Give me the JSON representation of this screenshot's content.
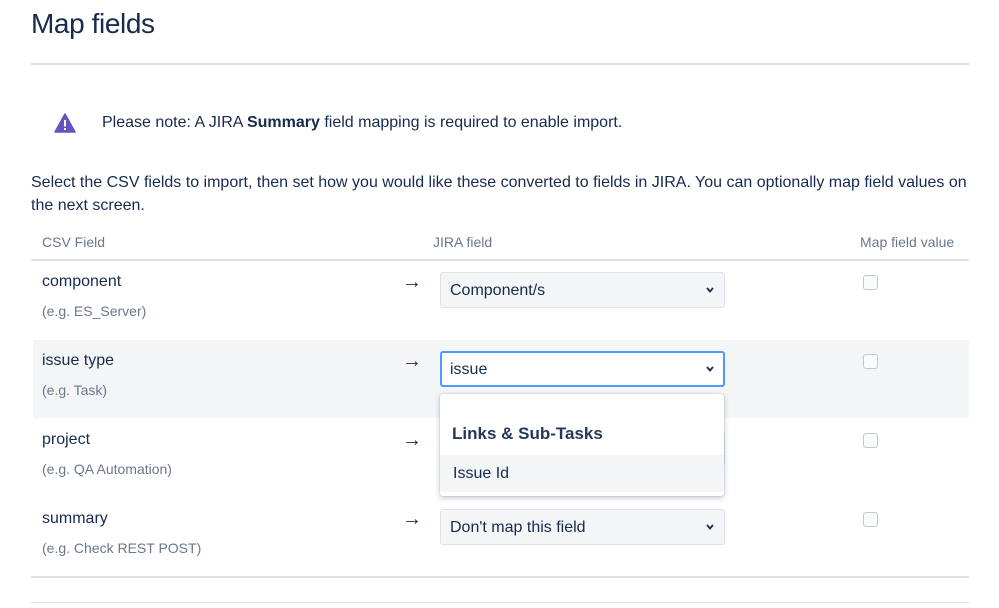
{
  "page": {
    "title": "Map fields"
  },
  "note": {
    "prefix": "Please note: A JIRA ",
    "bold": "Summary",
    "suffix": " field mapping is required to enable import."
  },
  "intro": "Select the CSV fields to import, then set how you would like these converted to fields in JIRA. You can optionally map field values on the next screen.",
  "table": {
    "headers": {
      "csv": "CSV Field",
      "jira": "JIRA field",
      "map": "Map field value"
    },
    "rows": [
      {
        "name": "component",
        "example": "(e.g. ES_Server)",
        "jira_value": "Component/s",
        "map_checked": false
      },
      {
        "name": "issue type",
        "example": "(e.g. Task)",
        "jira_value": "issue",
        "map_checked": false
      },
      {
        "name": "project",
        "example": "(e.g. QA Automation)",
        "jira_value": "",
        "map_checked": false
      },
      {
        "name": "summary",
        "example": "(e.g. Check REST POST)",
        "jira_value": "Don't map this field",
        "map_checked": false
      }
    ]
  },
  "dropdown": {
    "group_label": "Links & Sub-Tasks",
    "options": [
      {
        "label": "Issue Id"
      }
    ]
  },
  "icons": {
    "warning": "warning-icon",
    "arrow": "arrow-right-icon",
    "chevron": "chevron-down-icon"
  },
  "colors": {
    "warning": "#6554c0",
    "focus": "#4c9aff"
  }
}
